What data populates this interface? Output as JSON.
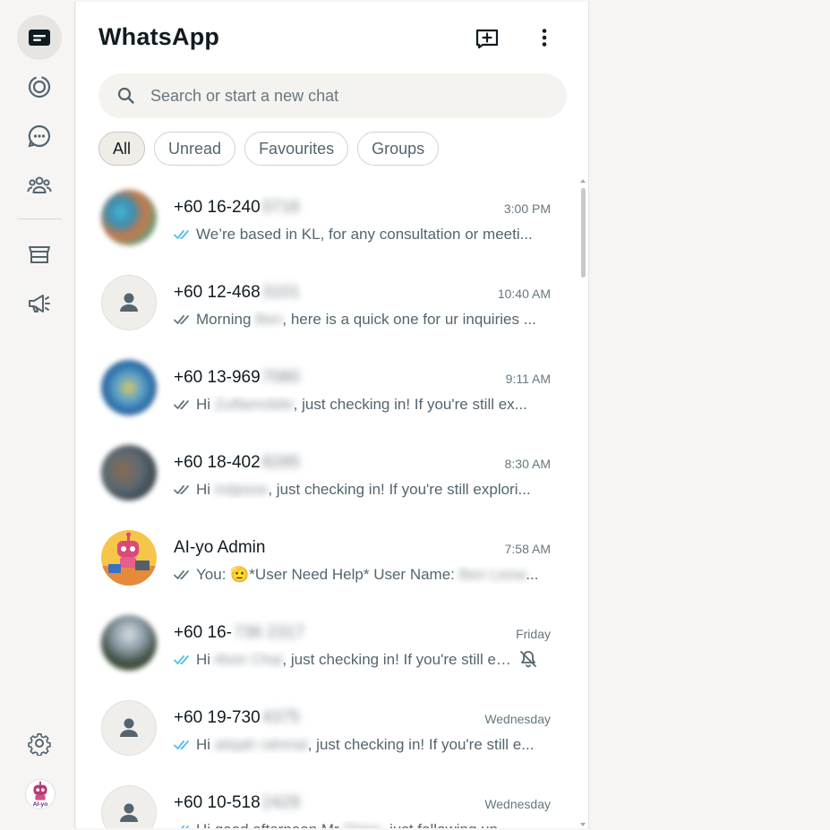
{
  "app": {
    "title": "WhatsApp"
  },
  "rail": {
    "items": [
      {
        "name": "chats",
        "icon": "chats-icon",
        "active": true
      },
      {
        "name": "status",
        "icon": "status-icon"
      },
      {
        "name": "channels",
        "icon": "channels-icon"
      },
      {
        "name": "communities",
        "icon": "communities-icon"
      },
      {
        "name": "catalog",
        "icon": "store-icon"
      },
      {
        "name": "advertise",
        "icon": "megaphone-icon"
      }
    ],
    "settings_icon": "gear-icon",
    "profile_text": "AI-yo"
  },
  "header": {
    "new_chat_icon": "new-chat-icon",
    "menu_icon": "kebab-menu-icon"
  },
  "search": {
    "placeholder": "Search or start a new chat",
    "value": ""
  },
  "filters": [
    {
      "label": "All",
      "active": true
    },
    {
      "label": "Unread"
    },
    {
      "label": "Favourites"
    },
    {
      "label": "Groups"
    }
  ],
  "colors": {
    "read_tick": "#53bdeb",
    "delivered_tick": "#8696a0",
    "accent": "#111b21"
  },
  "chats": [
    {
      "name": "+60 16-240",
      "hidden": "0716",
      "time": "3:00 PM",
      "tick": "read",
      "preview_a": "We’re based in KL, for any consultation or meeti...",
      "preview_hidden": "",
      "preview_b": "",
      "avatar": "photo-1"
    },
    {
      "name": "+60 12-468",
      "hidden": "3101",
      "time": "10:40 AM",
      "tick": "delivered",
      "preview_a": "Morning ",
      "preview_hidden": "Ben",
      "preview_b": ", here is a quick one for ur inquiries ...",
      "avatar": "default"
    },
    {
      "name": "+60 13-969",
      "hidden": "7080",
      "time": "9:11 AM",
      "tick": "delivered",
      "preview_a": "Hi ",
      "preview_hidden": "Zulfamobile",
      "preview_b": ", just checking in! If you're still ex...",
      "avatar": "photo-2"
    },
    {
      "name": "+60 18-402",
      "hidden": "8285",
      "time": "8:30 AM",
      "tick": "delivered",
      "preview_a": "Hi ",
      "preview_hidden": "indpsoe",
      "preview_b": ", just checking in! If you're still explori...",
      "avatar": "photo-3"
    },
    {
      "name": "AI-yo Admin",
      "hidden": "",
      "time": "7:58 AM",
      "tick": "delivered",
      "preview_a": "You: 🫡*User Need Help* User Name: ",
      "preview_hidden": "Ben Leow",
      "preview_b": "...",
      "avatar": "robot"
    },
    {
      "name": "+60 16-",
      "hidden": "736 2317",
      "time": "Friday",
      "tick": "read",
      "preview_a": "Hi ",
      "preview_hidden": "Alvin Chai",
      "preview_b": ", just checking in! If you're still ex...",
      "avatar": "photo-4",
      "muted": true
    },
    {
      "name": "+60 19-730",
      "hidden": "4375",
      "time": "Wednesday",
      "tick": "read",
      "preview_a": "Hi ",
      "preview_hidden": "atiqah rahmat",
      "preview_b": ", just checking in! If you're still e...",
      "avatar": "default"
    },
    {
      "name": "+60 10-518",
      "hidden": "2429",
      "time": "Wednesday",
      "tick": "read",
      "preview_a": "Hi good afternoon Mr ",
      "preview_hidden": "Thian",
      "preview_b": ", just following up...",
      "avatar": "default"
    }
  ]
}
